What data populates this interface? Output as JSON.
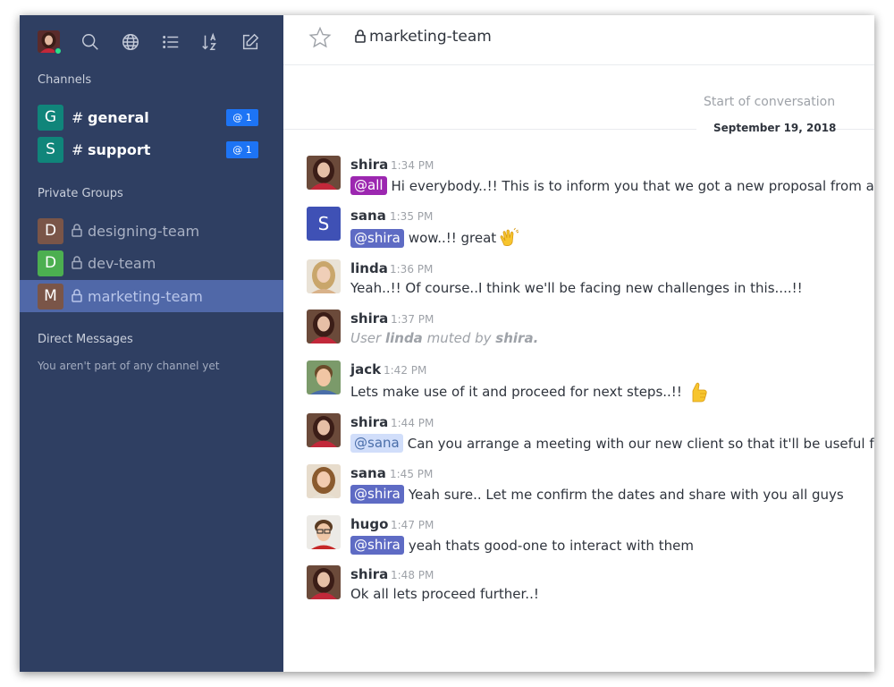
{
  "sidebar": {
    "channels_title": "Channels",
    "channels": [
      {
        "letter": "G",
        "prefix": "#",
        "name": "general",
        "badge": "@ 1",
        "color": "#10857a"
      },
      {
        "letter": "S",
        "prefix": "#",
        "name": "support",
        "badge": "@ 1",
        "color": "#10857a"
      }
    ],
    "private_title": "Private Groups",
    "private_groups": [
      {
        "letter": "D",
        "name": "designing-team",
        "color": "#7a5548"
      },
      {
        "letter": "D",
        "name": "dev-team",
        "color": "#4caf50"
      },
      {
        "letter": "M",
        "name": "marketing-team",
        "color": "#7a5548",
        "active": true
      }
    ],
    "dm_title": "Direct Messages",
    "dm_empty": "You aren't part of any channel yet",
    "toolbar_icons": [
      "user-avatar",
      "search-icon",
      "globe-icon",
      "list-icon",
      "sort-icon",
      "compose-icon"
    ]
  },
  "header": {
    "room_name": "marketing-team"
  },
  "conversation": {
    "start_label": "Start of conversation",
    "date": "September 19, 2018",
    "messages": [
      {
        "user": "shira",
        "time": "1:34 PM",
        "mention": "@all",
        "text": "Hi everybody..!! This is to inform you that we got a new proposal from a client."
      },
      {
        "user": "sana",
        "time": "1:35 PM",
        "mention": "@shira",
        "text": "wow..!! great",
        "emoji": "clapping-hands"
      },
      {
        "user": "linda",
        "time": "1:36 PM",
        "text": "Yeah..!! Of course..I think we'll be facing new challenges in this....!!"
      },
      {
        "user": "shira",
        "time": "1:37 PM",
        "system": {
          "prefix": "User",
          "target": "linda",
          "mid": "muted by",
          "actor": "shira."
        }
      },
      {
        "user": "jack",
        "time": "1:42 PM",
        "text": "Lets make use of it and proceed for next steps..!!",
        "emoji": "thumbs-up"
      },
      {
        "user": "shira",
        "time": "1:44 PM",
        "mention": "@sana",
        "text": "Can you arrange a meeting with our new client so that it'll be useful for our"
      },
      {
        "user": "sana",
        "time": "1:45 PM",
        "mention": "@shira",
        "text": "Yeah sure.. Let me confirm the dates and share with you all guys"
      },
      {
        "user": "hugo",
        "time": "1:47 PM",
        "mention": "@shira",
        "text": "yeah thats good-one to interact with them"
      },
      {
        "user": "shira",
        "time": "1:48 PM",
        "text": "Ok all lets proceed further..!"
      }
    ]
  },
  "colors": {
    "sidebar_bg": "#2f3f62",
    "active_room": "#5068a8",
    "badge": "#1d74f5",
    "mention": "#5e6bc4",
    "mention_all": "#9c27b0",
    "mention_me": "#d1defa"
  }
}
